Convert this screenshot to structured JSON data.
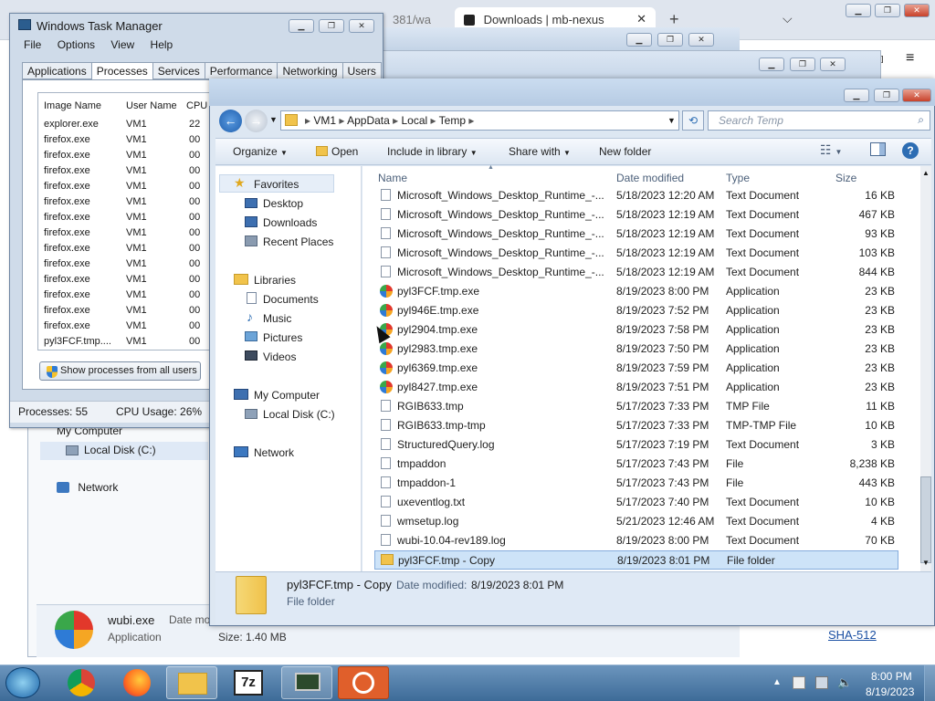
{
  "browser": {
    "tabs": [
      {
        "label": "381/wa"
      },
      {
        "label": "Downloads | mb-nexus"
      }
    ],
    "new_tab": "+",
    "link": "SHA-512"
  },
  "behind_explorer": {
    "nav": [
      {
        "label": "My Computer"
      },
      {
        "label": "Local Disk (C:)"
      },
      {
        "label": "Network"
      }
    ],
    "details": {
      "name": "wubi.exe",
      "type": "Application",
      "date_label": "Date mo",
      "size": "Size: 1.40 MB"
    }
  },
  "task_manager": {
    "title": "Windows Task Manager",
    "menu": [
      "File",
      "Options",
      "View",
      "Help"
    ],
    "tabs": [
      "Applications",
      "Processes",
      "Services",
      "Performance",
      "Networking",
      "Users"
    ],
    "columns": [
      "Image Name",
      "User Name",
      "CPU"
    ],
    "rows": [
      [
        "explorer.exe",
        "VM1",
        "22"
      ],
      [
        "firefox.exe",
        "VM1",
        "00"
      ],
      [
        "firefox.exe",
        "VM1",
        "00"
      ],
      [
        "firefox.exe",
        "VM1",
        "00"
      ],
      [
        "firefox.exe",
        "VM1",
        "00"
      ],
      [
        "firefox.exe",
        "VM1",
        "00"
      ],
      [
        "firefox.exe",
        "VM1",
        "00"
      ],
      [
        "firefox.exe",
        "VM1",
        "00"
      ],
      [
        "firefox.exe",
        "VM1",
        "00"
      ],
      [
        "firefox.exe",
        "VM1",
        "00"
      ],
      [
        "firefox.exe",
        "VM1",
        "00"
      ],
      [
        "firefox.exe",
        "VM1",
        "00"
      ],
      [
        "firefox.exe",
        "VM1",
        "00"
      ],
      [
        "firefox.exe",
        "VM1",
        "00"
      ],
      [
        "pyl3FCF.tmp....",
        "VM1",
        "00"
      ]
    ],
    "show_all_button": "Show processes from all users",
    "status": {
      "processes": "Processes: 55",
      "cpu": "CPU Usage: 26%"
    }
  },
  "explorer": {
    "breadcrumb": [
      "VM1",
      "AppData",
      "Local",
      "Temp"
    ],
    "search_placeholder": "Search Temp",
    "toolbar": {
      "organize": "Organize",
      "open": "Open",
      "include": "Include in library",
      "share": "Share with",
      "new_folder": "New folder"
    },
    "nav": {
      "favorites": "Favorites",
      "desktop": "Desktop",
      "downloads": "Downloads",
      "recent": "Recent Places",
      "libraries": "Libraries",
      "documents": "Documents",
      "music": "Music",
      "pictures": "Pictures",
      "videos": "Videos",
      "computer": "My Computer",
      "local_disk": "Local Disk (C:)",
      "network": "Network"
    },
    "columns": {
      "name": "Name",
      "date": "Date modified",
      "type": "Type",
      "size": "Size"
    },
    "files": [
      {
        "name": "Microsoft_Windows_Desktop_Runtime_-...",
        "date": "5/18/2023 12:20 AM",
        "type": "Text Document",
        "size": "16 KB",
        "icon": "doc"
      },
      {
        "name": "Microsoft_Windows_Desktop_Runtime_-...",
        "date": "5/18/2023 12:19 AM",
        "type": "Text Document",
        "size": "467 KB",
        "icon": "doc"
      },
      {
        "name": "Microsoft_Windows_Desktop_Runtime_-...",
        "date": "5/18/2023 12:19 AM",
        "type": "Text Document",
        "size": "93 KB",
        "icon": "doc"
      },
      {
        "name": "Microsoft_Windows_Desktop_Runtime_-...",
        "date": "5/18/2023 12:19 AM",
        "type": "Text Document",
        "size": "103 KB",
        "icon": "doc"
      },
      {
        "name": "Microsoft_Windows_Desktop_Runtime_-...",
        "date": "5/18/2023 12:19 AM",
        "type": "Text Document",
        "size": "844 KB",
        "icon": "doc"
      },
      {
        "name": "pyl3FCF.tmp.exe",
        "date": "8/19/2023 8:00 PM",
        "type": "Application",
        "size": "23 KB",
        "icon": "app"
      },
      {
        "name": "pyl946E.tmp.exe",
        "date": "8/19/2023 7:52 PM",
        "type": "Application",
        "size": "23 KB",
        "icon": "app"
      },
      {
        "name": "pyl2904.tmp.exe",
        "date": "8/19/2023 7:58 PM",
        "type": "Application",
        "size": "23 KB",
        "icon": "app"
      },
      {
        "name": "pyl2983.tmp.exe",
        "date": "8/19/2023 7:50 PM",
        "type": "Application",
        "size": "23 KB",
        "icon": "app"
      },
      {
        "name": "pyl6369.tmp.exe",
        "date": "8/19/2023 7:59 PM",
        "type": "Application",
        "size": "23 KB",
        "icon": "app"
      },
      {
        "name": "pyl8427.tmp.exe",
        "date": "8/19/2023 7:51 PM",
        "type": "Application",
        "size": "23 KB",
        "icon": "app"
      },
      {
        "name": "RGIB633.tmp",
        "date": "5/17/2023 7:33 PM",
        "type": "TMP File",
        "size": "11 KB",
        "icon": "doc"
      },
      {
        "name": "RGIB633.tmp-tmp",
        "date": "5/17/2023 7:33 PM",
        "type": "TMP-TMP File",
        "size": "10 KB",
        "icon": "doc"
      },
      {
        "name": "StructuredQuery.log",
        "date": "5/17/2023 7:19 PM",
        "type": "Text Document",
        "size": "3 KB",
        "icon": "doc"
      },
      {
        "name": "tmpaddon",
        "date": "5/17/2023 7:43 PM",
        "type": "File",
        "size": "8,238 KB",
        "icon": "doc"
      },
      {
        "name": "tmpaddon-1",
        "date": "5/17/2023 7:43 PM",
        "type": "File",
        "size": "443 KB",
        "icon": "doc"
      },
      {
        "name": "uxeventlog.txt",
        "date": "5/17/2023 7:40 PM",
        "type": "Text Document",
        "size": "10 KB",
        "icon": "doc"
      },
      {
        "name": "wmsetup.log",
        "date": "5/21/2023 12:46 AM",
        "type": "Text Document",
        "size": "4 KB",
        "icon": "doc"
      },
      {
        "name": "wubi-10.04-rev189.log",
        "date": "8/19/2023 8:00 PM",
        "type": "Text Document",
        "size": "70 KB",
        "icon": "doc"
      },
      {
        "name": "pyl3FCF.tmp - Copy",
        "date": "8/19/2023 8:01 PM",
        "type": "File folder",
        "size": "",
        "icon": "folder"
      }
    ],
    "selected_index": 19,
    "details": {
      "name": "pyl3FCF.tmp - Copy",
      "date_label": "Date modified:",
      "date": "8/19/2023 8:01 PM",
      "kind": "File folder"
    }
  },
  "taskbar": {
    "time": "8:00 PM",
    "date": "8/19/2023",
    "seven_zip": "7z"
  }
}
